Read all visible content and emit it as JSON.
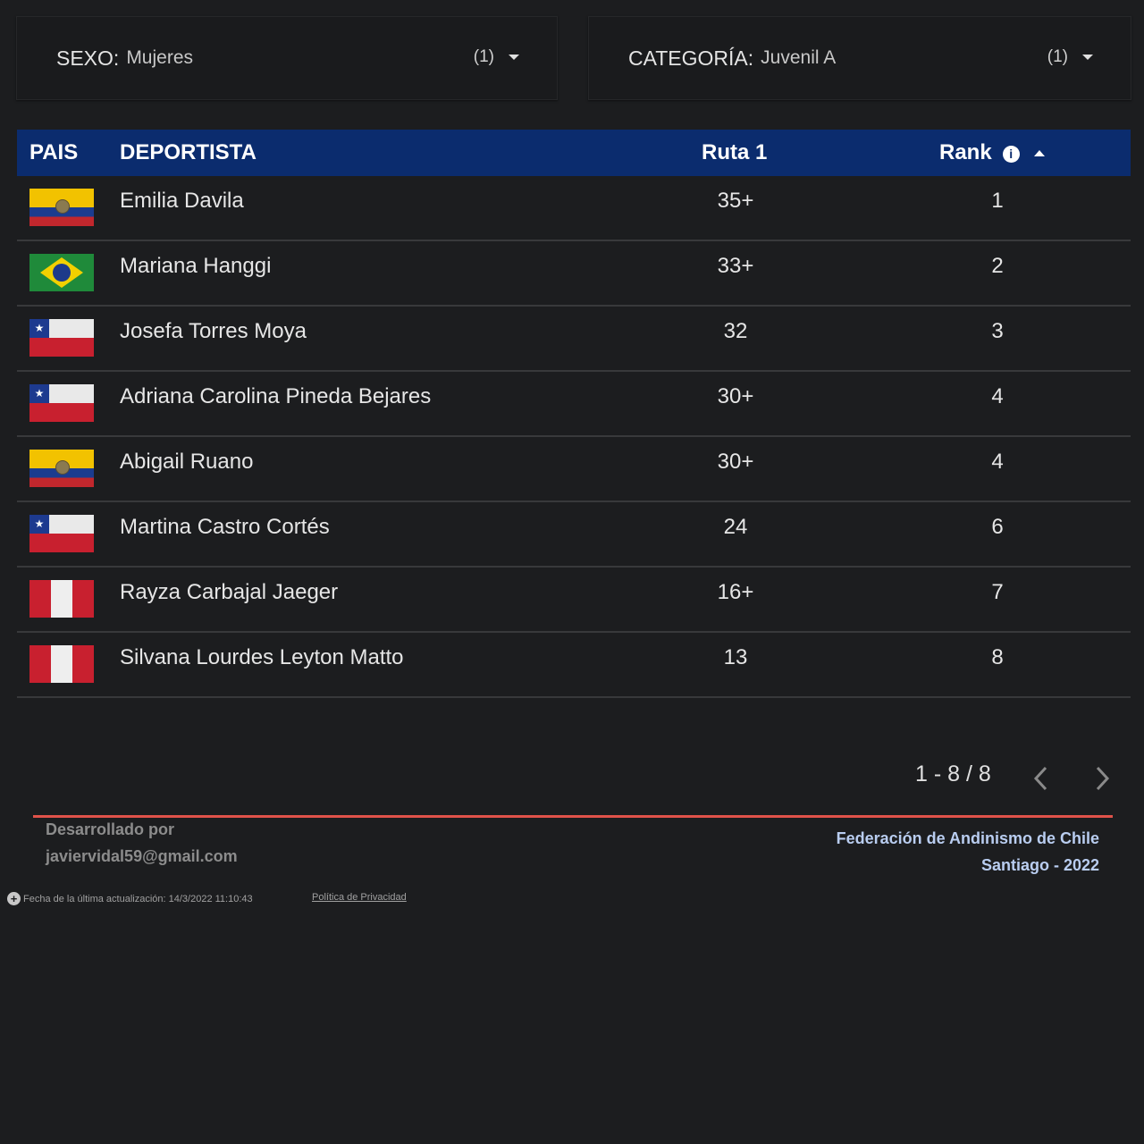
{
  "filters": [
    {
      "label": "SEXO:",
      "value": "Mujeres",
      "count": "(1)"
    },
    {
      "label": "CATEGORÍA:",
      "value": "Juvenil A",
      "count": "(1)"
    }
  ],
  "table": {
    "headers": {
      "pais": "PAIS",
      "deportista": "DEPORTISTA",
      "ruta": "Ruta 1",
      "rank": "Rank"
    },
    "info_icon": "i",
    "rows": [
      {
        "flag": "ecuador",
        "name": "Emilia Davila",
        "ruta": "35+",
        "rank": "1"
      },
      {
        "flag": "brazil",
        "name": "Mariana Hanggi",
        "ruta": "33+",
        "rank": "2"
      },
      {
        "flag": "chile",
        "name": "Josefa Torres Moya",
        "ruta": "32",
        "rank": "3"
      },
      {
        "flag": "chile",
        "name": "Adriana Carolina Pineda Bejares",
        "ruta": "30+",
        "rank": "4"
      },
      {
        "flag": "ecuador",
        "name": "Abigail Ruano",
        "ruta": "30+",
        "rank": "4"
      },
      {
        "flag": "chile",
        "name": "Martina Castro Cortés",
        "ruta": "24",
        "rank": "6"
      },
      {
        "flag": "peru",
        "name": "Rayza Carbajal Jaeger",
        "ruta": "16+",
        "rank": "7"
      },
      {
        "flag": "peru",
        "name": "Silvana Lourdes Leyton Matto",
        "ruta": "13",
        "rank": "8"
      }
    ]
  },
  "pagination": {
    "text": "1 - 8 / 8"
  },
  "footer": {
    "dev_line1": "Desarrollado por",
    "dev_line2": "javiervidal59@gmail.com",
    "org_line1": "Federación de Andinismo de Chile",
    "org_line2": "Santiago - 2022",
    "updated": "Fecha de la última actualización: 14/3/2022 11:10:43",
    "privacy": "Política de Privacidad"
  },
  "colors": {
    "header_bg": "#0b2c6e",
    "page_bg": "#1c1d1f",
    "accent_line": "#e0524a",
    "org_text": "#b9cdf0"
  }
}
